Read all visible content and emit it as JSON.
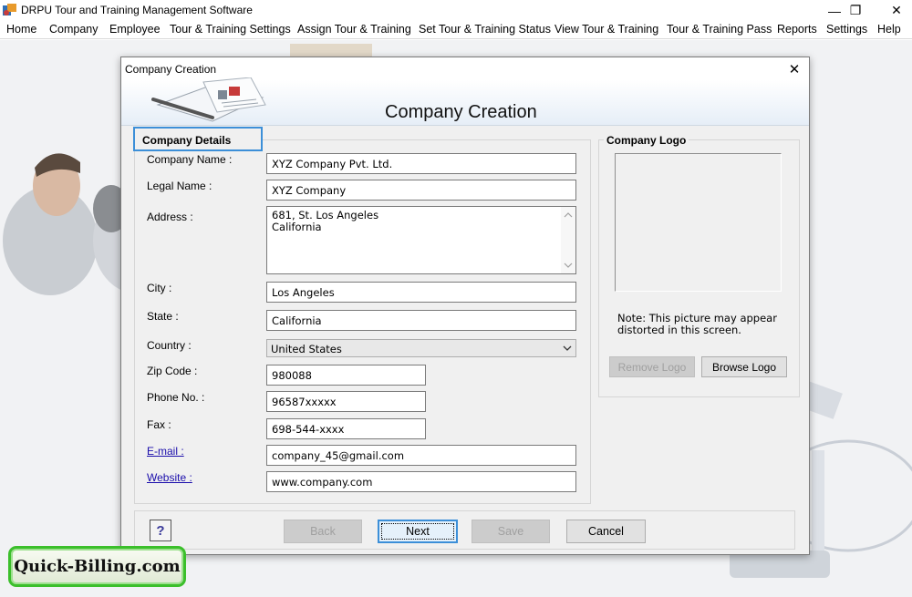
{
  "window": {
    "title": "DRPU Tour and Training Management Software",
    "minimize_glyph": "—",
    "restore_glyph": "❐",
    "close_glyph": "✕"
  },
  "menu": [
    {
      "label": "Home"
    },
    {
      "label": "Company"
    },
    {
      "label": "Employee"
    },
    {
      "label": "Tour & Training Settings"
    },
    {
      "label": "Assign Tour & Training"
    },
    {
      "label": "Set Tour & Training Status"
    },
    {
      "label": "View Tour & Training"
    },
    {
      "label": "Tour & Training Pass"
    },
    {
      "label": "Reports"
    },
    {
      "label": "Settings"
    },
    {
      "label": "Help"
    }
  ],
  "dialog": {
    "title": "Company Creation",
    "close_glyph": "✕",
    "banner_title": "Company Creation",
    "details_group": "Company Details",
    "fields": {
      "company_name": {
        "label": "Company Name :",
        "value": "XYZ Company Pvt. Ltd."
      },
      "legal_name": {
        "label": "Legal Name :",
        "value": "XYZ Company"
      },
      "address": {
        "label": "Address :",
        "line1": "681, St. Los Angeles",
        "line2": "California"
      },
      "city": {
        "label": "City :",
        "value": "Los Angeles"
      },
      "state": {
        "label": "State :",
        "value": "California"
      },
      "country": {
        "label": "Country :",
        "value": "United States"
      },
      "zip": {
        "label": "Zip Code :",
        "value": "980088"
      },
      "phone": {
        "label": "Phone No. :",
        "value": "96587xxxxx"
      },
      "fax": {
        "label": "Fax :",
        "value": "698-544-xxxx"
      },
      "email": {
        "label": "E-mail :",
        "value": "company_45@gmail.com"
      },
      "website": {
        "label": "Website :",
        "value": "www.company.com"
      }
    },
    "logo": {
      "group": "Company Logo",
      "note_line1": "Note: This picture may appear",
      "note_line2": "distorted in this screen.",
      "remove_label": "Remove Logo",
      "browse_label": "Browse Logo"
    },
    "buttons": {
      "help_glyph": "?",
      "back": "Back",
      "next": "Next",
      "save": "Save",
      "cancel": "Cancel"
    }
  },
  "badge": {
    "text": "Quick-Billing.com"
  }
}
